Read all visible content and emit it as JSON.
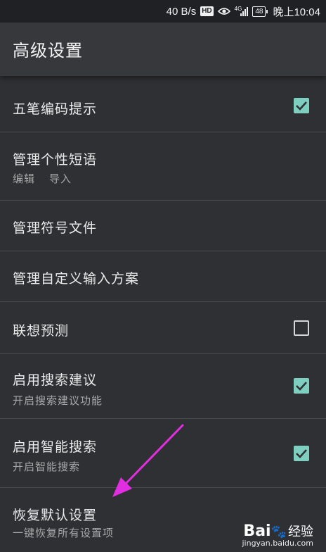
{
  "status_bar": {
    "speed": "40 B/s",
    "hd": "HD",
    "network": "4G",
    "battery": "48",
    "time": "晚上10:04"
  },
  "header": {
    "title": "高级设置"
  },
  "settings": [
    {
      "title": "五笔编码提示",
      "checked": true
    },
    {
      "title": "管理个性短语",
      "sub_edit": "编辑",
      "sub_import": "导入"
    },
    {
      "title": "管理符号文件"
    },
    {
      "title": "管理自定义输入方案"
    },
    {
      "title": "联想预测",
      "checked": false
    },
    {
      "title": "启用搜索建议",
      "subtitle": "开启搜索建议功能",
      "checked": true
    },
    {
      "title": "启用智能搜索",
      "subtitle": "开启智能搜索",
      "checked": true
    },
    {
      "title": "恢复默认设置",
      "subtitle": "一键恢复所有设置项"
    }
  ],
  "watermark": {
    "logo_left": "Bai",
    "logo_right": "经验",
    "url": "jingyan.baidu.com"
  },
  "colors": {
    "accent": "#7fcfc1",
    "arrow": "#e02ee0"
  }
}
